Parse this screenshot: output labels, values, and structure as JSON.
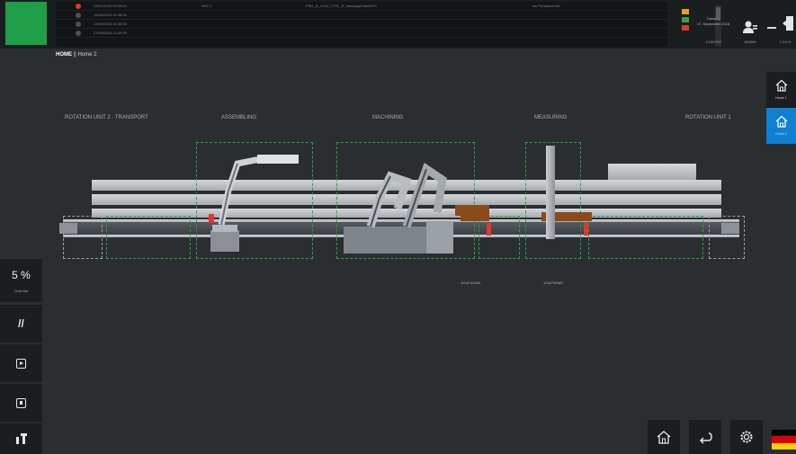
{
  "header": {
    "messages": [
      {
        "severity": "alarm",
        "timestamp": "23/01/2018 09:00:00",
        "source": "HPC 1",
        "text": "PRG_B_CON_CTRL_R_MessageClientSPC",
        "info": "No Persistent Alt!"
      },
      {
        "severity": "info",
        "timestamp": "15/09/2018 15:35:09",
        "source": "",
        "text": "",
        "info": ""
      },
      {
        "severity": "info",
        "timestamp": "13/09/2018 13:39:39",
        "source": "",
        "text": "",
        "info": ""
      },
      {
        "severity": "info",
        "timestamp": "27/09/2018 13:30:39",
        "source": "",
        "text": "",
        "info": ""
      }
    ],
    "weekday": "Tuesday",
    "date": "17. September 2018",
    "time": "13:58 PM",
    "user": "ADMIN",
    "version": "1.0.0.0"
  },
  "breadcrumb": {
    "root": "HOME",
    "separator": "||",
    "current": "Home 2"
  },
  "nav": {
    "home1_label": "Home 1",
    "home2_label": "Home 2"
  },
  "stations": [
    "ROTATION UNIT 2 · TRANSPORT",
    "ASSEMBLING",
    "MACHINING",
    "MEASURING",
    "ROTATION UNIT 1"
  ],
  "serials": [
    "1016744344",
    "1016794587"
  ],
  "override": {
    "value": "5 %",
    "label": "Override"
  },
  "colors": {
    "accent_green": "#1e9e46",
    "active_nav": "#0e7fd2",
    "alarm_red": "#e2362f",
    "panel_dark": "#1b1e20",
    "background": "#2a2e31",
    "station_frame": "#2f9e4b",
    "part_brown": "#8a4a1c"
  },
  "icons": {
    "user": "user-icon",
    "minimize": "minimize-icon",
    "exit": "exit-icon",
    "home": "home-icon",
    "back": "back-icon",
    "settings": "gear-icon",
    "language": "german-flag-icon",
    "left_panel": [
      "override-icon",
      "pause-icon",
      "play-icon",
      "stop-icon",
      "robot-icon"
    ]
  }
}
